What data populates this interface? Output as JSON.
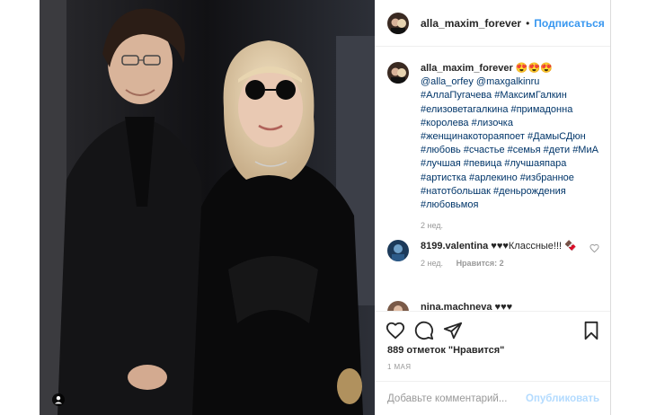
{
  "post": {
    "username": "alla_maxim_forever",
    "separator": "•",
    "follow_label": "Подписаться",
    "photo_alt": "photo"
  },
  "caption": {
    "username": "alla_maxim_forever",
    "emoji": "😍😍😍",
    "mentions": "@alla_orfey @maxgalkinru",
    "hashtags": "#АллаПугачева #МаксимГалкин #елизоветагалкина #примадонна #королева #лизочка #женщинакотораяпоет #ДамыСДюн #любовь #счастье #семья #дети #МиА #лучшая #певица #лучшаяпара #артистка #арлекино #избранное #натотбольшак #деньрождения #любовьмоя",
    "time": "2 нед."
  },
  "comments": [
    {
      "username": "8199.valentina",
      "text": "♥♥♥Классные!!! 🍫",
      "time": "2 нед.",
      "reply_label": "Нравится: 2"
    },
    {
      "username": "nina.machneva",
      "text": "♥♥♥",
      "time": "",
      "reply_label": ""
    }
  ],
  "icons": {
    "like": "heart-icon",
    "comment": "comment-icon",
    "share": "share-icon",
    "save": "bookmark-icon",
    "tag": "user-tag-icon"
  },
  "likes_label": "889 отметок \"Нравится\"",
  "date_label": "1 МАЯ",
  "add_comment": {
    "placeholder": "Добавьте комментарий...",
    "post_label": "Опубликовать"
  },
  "colors": {
    "accent": "#3897f0",
    "hashtag": "#003569",
    "muted": "#999999",
    "post_disabled": "#b3dbff"
  }
}
